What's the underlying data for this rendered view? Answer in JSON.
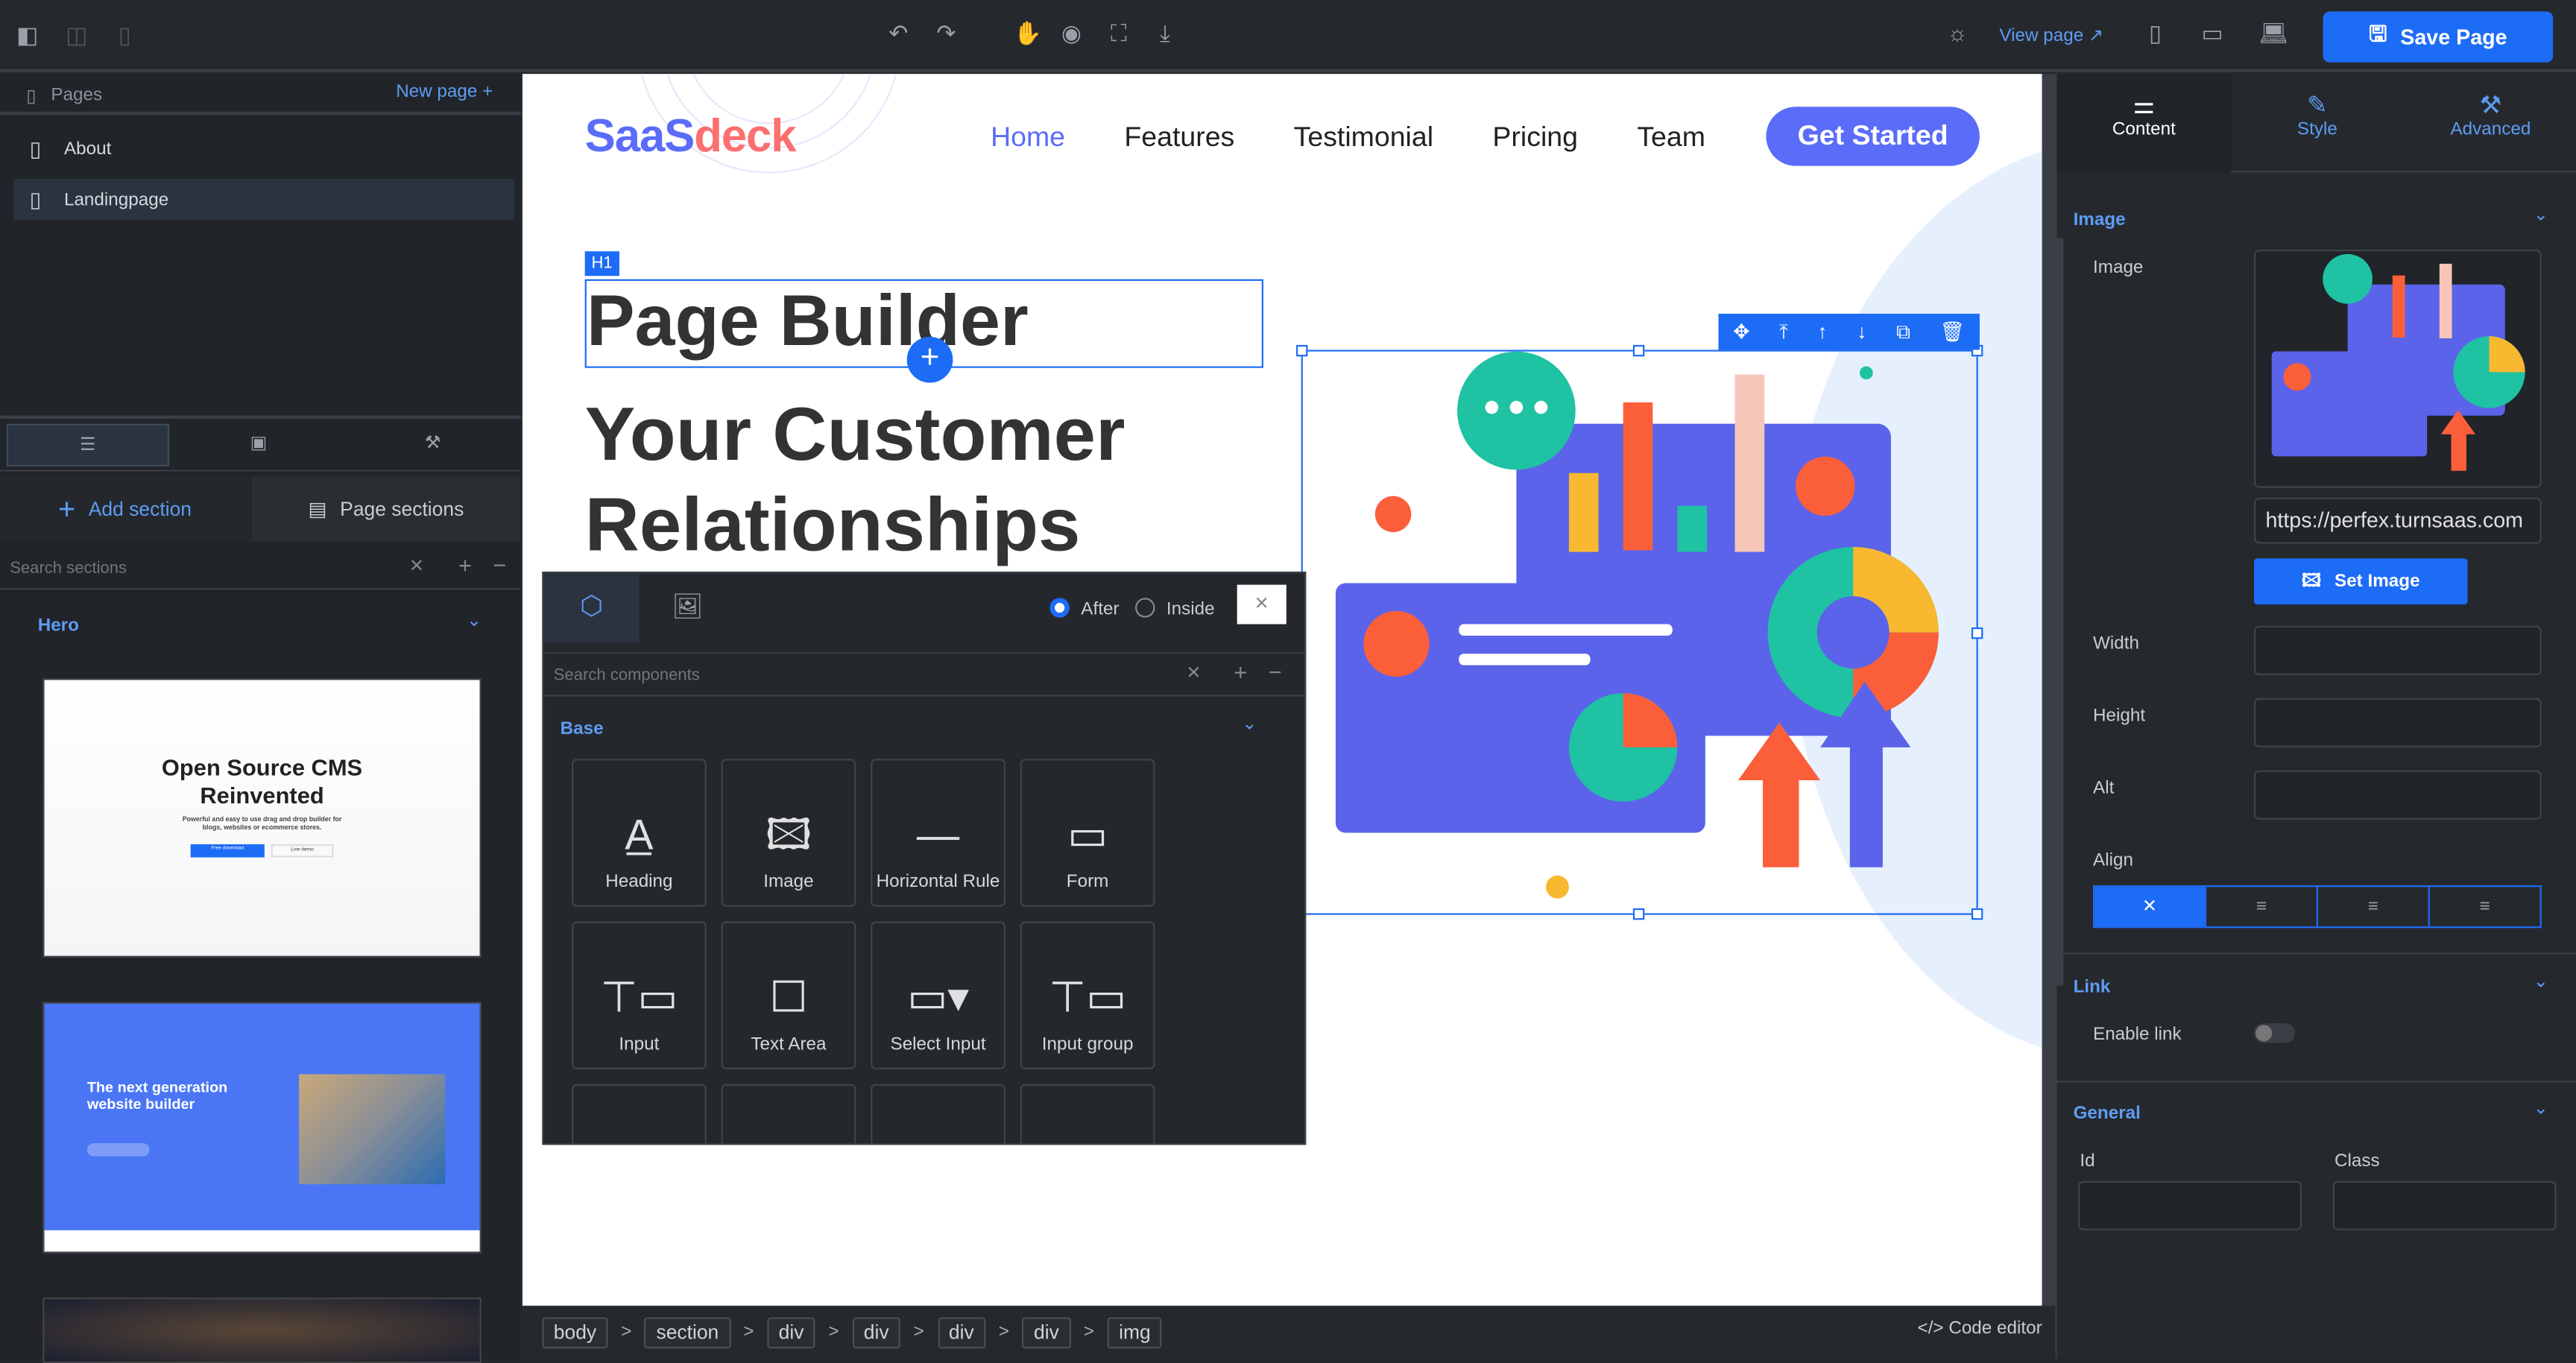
{
  "topbar": {
    "view_page": "View page",
    "save_page": "Save Page",
    "icons": [
      "layout-left-icon",
      "layout-split-icon",
      "layout-right-icon",
      "undo-icon",
      "redo-icon",
      "hand-icon",
      "eye-icon",
      "fullscreen-icon",
      "download-icon",
      "sun-icon",
      "external-link-icon",
      "mobile-icon",
      "tablet-icon",
      "desktop-icon",
      "save-icon"
    ]
  },
  "pages": {
    "title": "Pages",
    "new_page": "New page +",
    "items": [
      {
        "label": "About"
      },
      {
        "label": "Landingpage"
      }
    ]
  },
  "left_tabs": [
    "sections-icon",
    "components-icon",
    "tools-icon"
  ],
  "sections": {
    "add_section": "Add section",
    "page_sections": "Page sections",
    "search_placeholder": "Search sections",
    "group": "Hero",
    "thumbs": [
      {
        "title": "Open Source CMS Reinvented",
        "subtitle": "Powerful and easy to use drag and drop builder for blogs, websites or ecommerce stores.",
        "btn1": "Free download",
        "btn2": "Live demo"
      },
      {
        "title": "The next generation website builder"
      }
    ]
  },
  "site": {
    "logo_a": "SaaS",
    "logo_b": "deck",
    "nav": [
      "Home",
      "Features",
      "Testimonial",
      "Pricing",
      "Team"
    ],
    "cta": "Get Started",
    "h1_badge": "H1",
    "h1": "Page Builder",
    "h2": "Your Customer Relationships"
  },
  "popup": {
    "after": "After",
    "inside": "Inside",
    "search_placeholder": "Search components",
    "group": "Base",
    "components": [
      "Heading",
      "Image",
      "Horizontal Rule",
      "Form",
      "Input",
      "Text Area",
      "Select Input",
      "Input group"
    ]
  },
  "breadcrumb": [
    "body",
    "section",
    "div",
    "div",
    "div",
    "div",
    "img"
  ],
  "code_editor": "</> Code editor",
  "inspector": {
    "tabs": [
      "Content",
      "Style",
      "Advanced"
    ],
    "image_section": "Image",
    "image_label": "Image",
    "image_url": "https://perfex.turnsaas.com",
    "set_image": "Set Image",
    "width": "Width",
    "height": "Height",
    "alt": "Alt",
    "align": "Align",
    "link_section": "Link",
    "enable_link": "Enable link",
    "enable_link_on": false,
    "general_section": "General",
    "id": "Id",
    "class": "Class"
  },
  "colors": {
    "accent": "#1d6cf5",
    "brand_blue": "#5b6cf9",
    "brand_red": "#fb6f6f",
    "panel": "#25292e"
  }
}
